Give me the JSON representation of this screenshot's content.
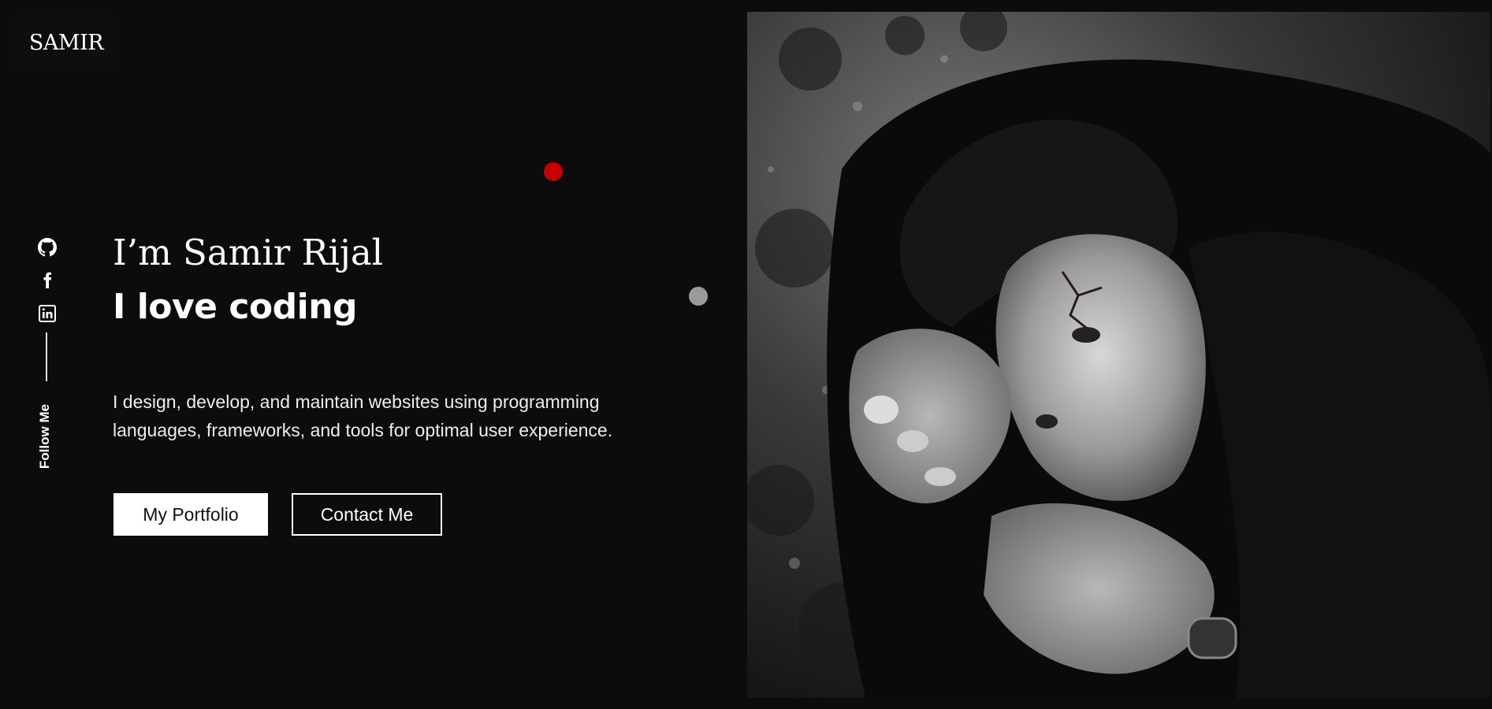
{
  "header": {
    "logo": "SAMIR",
    "icons": {
      "theme_toggle": "contrast-icon",
      "menu": "hamburger-menu-icon"
    }
  },
  "social": {
    "items": [
      {
        "name": "GitHub",
        "icon": "github-icon"
      },
      {
        "name": "Facebook",
        "icon": "facebook-icon"
      },
      {
        "name": "LinkedIn",
        "icon": "linkedin-icon"
      }
    ],
    "follow_label": "Follow Me"
  },
  "hero": {
    "title": "I’m Samir Rijal",
    "subtitle": "I love coding",
    "description": "I design, develop, and maintain websites using programming languages, frameworks, and tools for optimal user experience.",
    "buttons": {
      "portfolio": "My Portfolio",
      "contact": "Contact Me"
    }
  },
  "colors": {
    "background": "#0c0c0d",
    "text": "#ffffff",
    "accent_dot": "#c40000",
    "secondary_dot": "#9a9a9a"
  }
}
